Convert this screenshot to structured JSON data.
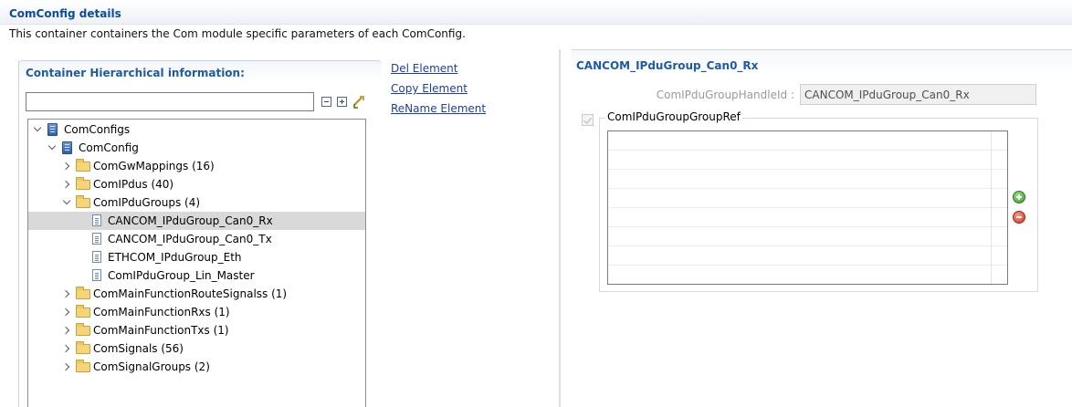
{
  "page": {
    "title": "ComConfig details",
    "description": "This container containers the Com module specific parameters of each ComConfig."
  },
  "hierarchy": {
    "title": "Container Hierarchical information:",
    "filter_value": "",
    "tree": [
      {
        "label": "ComConfigs",
        "icon": "config-icon",
        "expanded": true
      },
      {
        "label": "ComConfig",
        "icon": "config-icon",
        "expanded": true
      },
      {
        "label": "ComGwMappings (16)",
        "icon": "folder-icon",
        "expanded": false
      },
      {
        "label": "ComIPdus (40)",
        "icon": "folder-icon",
        "expanded": false
      },
      {
        "label": "ComIPduGroups (4)",
        "icon": "folder-icon",
        "expanded": true
      },
      {
        "label": "CANCOM_IPduGroup_Can0_Rx",
        "icon": "document-icon",
        "selected": true
      },
      {
        "label": "CANCOM_IPduGroup_Can0_Tx",
        "icon": "document-icon"
      },
      {
        "label": "ETHCOM_IPduGroup_Eth",
        "icon": "document-icon"
      },
      {
        "label": "ComIPduGroup_Lin_Master",
        "icon": "document-icon"
      },
      {
        "label": "ComMainFunctionRouteSignalss (1)",
        "icon": "folder-icon",
        "expanded": false
      },
      {
        "label": "ComMainFunctionRxs (1)",
        "icon": "folder-icon",
        "expanded": false
      },
      {
        "label": "ComMainFunctionTxs (1)",
        "icon": "folder-icon",
        "expanded": false
      },
      {
        "label": "ComSignals (56)",
        "icon": "folder-icon",
        "expanded": false
      },
      {
        "label": "ComSignalGroups (2)",
        "icon": "folder-icon",
        "expanded": false
      }
    ]
  },
  "actions": {
    "del": "Del Element",
    "copy": "Copy Element",
    "rename": "ReName Element"
  },
  "detail": {
    "title": "CANCOM_IPduGroup_Can0_Rx",
    "handle_label": "ComIPduGroupHandleId :",
    "handle_value": "CANCOM_IPduGroup_Can0_Rx",
    "group_ref_label": "ComIPduGroupGroupRef",
    "group_ref_checked": true,
    "group_ref_items": []
  }
}
